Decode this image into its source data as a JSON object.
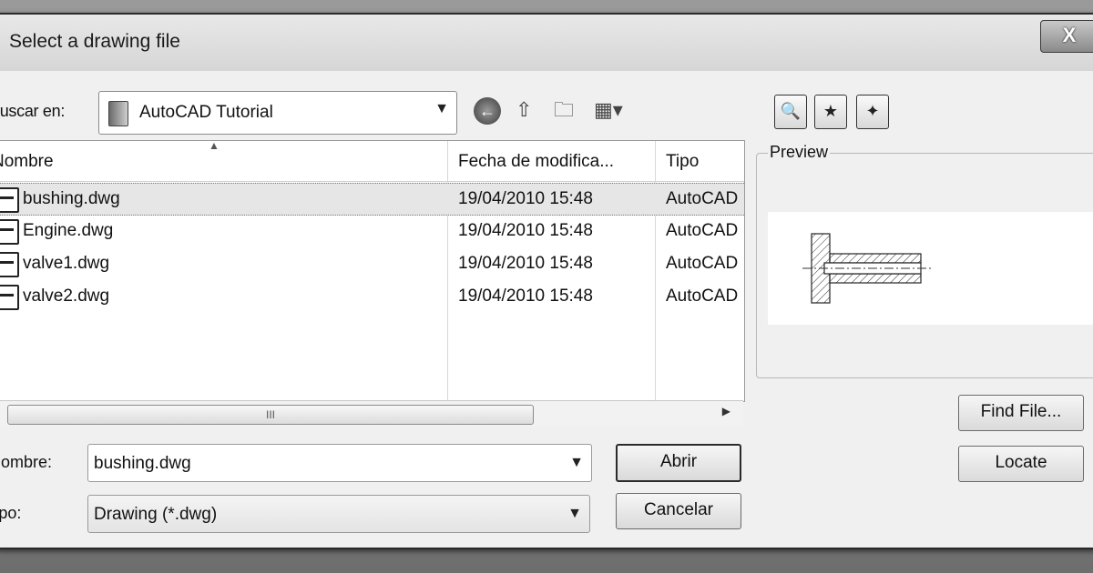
{
  "window": {
    "title": "Select a drawing file",
    "close_label": "X"
  },
  "lookin": {
    "label": "Buscar en:",
    "value": "AutoCAD Tutorial"
  },
  "toolbar": {
    "back_icon": "back-arrow-icon",
    "up_icon": "up-folder-icon",
    "new_folder_icon": "new-folder-icon",
    "views_icon": "views-menu-icon"
  },
  "file_list": {
    "columns": [
      "Nombre",
      "Fecha de modifica...",
      "Tipo"
    ],
    "rows": [
      {
        "name": "bushing.dwg",
        "date": "19/04/2010 15:48",
        "type": "AutoCAD"
      },
      {
        "name": "Engine.dwg",
        "date": "19/04/2010 15:48",
        "type": "AutoCAD"
      },
      {
        "name": "valve1.dwg",
        "date": "19/04/2010 15:48",
        "type": "AutoCAD"
      },
      {
        "name": "valve2.dwg",
        "date": "19/04/2010 15:48",
        "type": "AutoCAD"
      }
    ],
    "scroll_grip": "III"
  },
  "preview": {
    "label": "Preview"
  },
  "side_buttons": {
    "find_file": "Find File...",
    "locate": "Locate"
  },
  "filename": {
    "label": "Nombre:",
    "value": "bushing.dwg"
  },
  "filetype": {
    "label": "Tipo:",
    "value": "Drawing (*.dwg)"
  },
  "actions": {
    "open": "Abrir",
    "cancel": "Cancelar"
  }
}
